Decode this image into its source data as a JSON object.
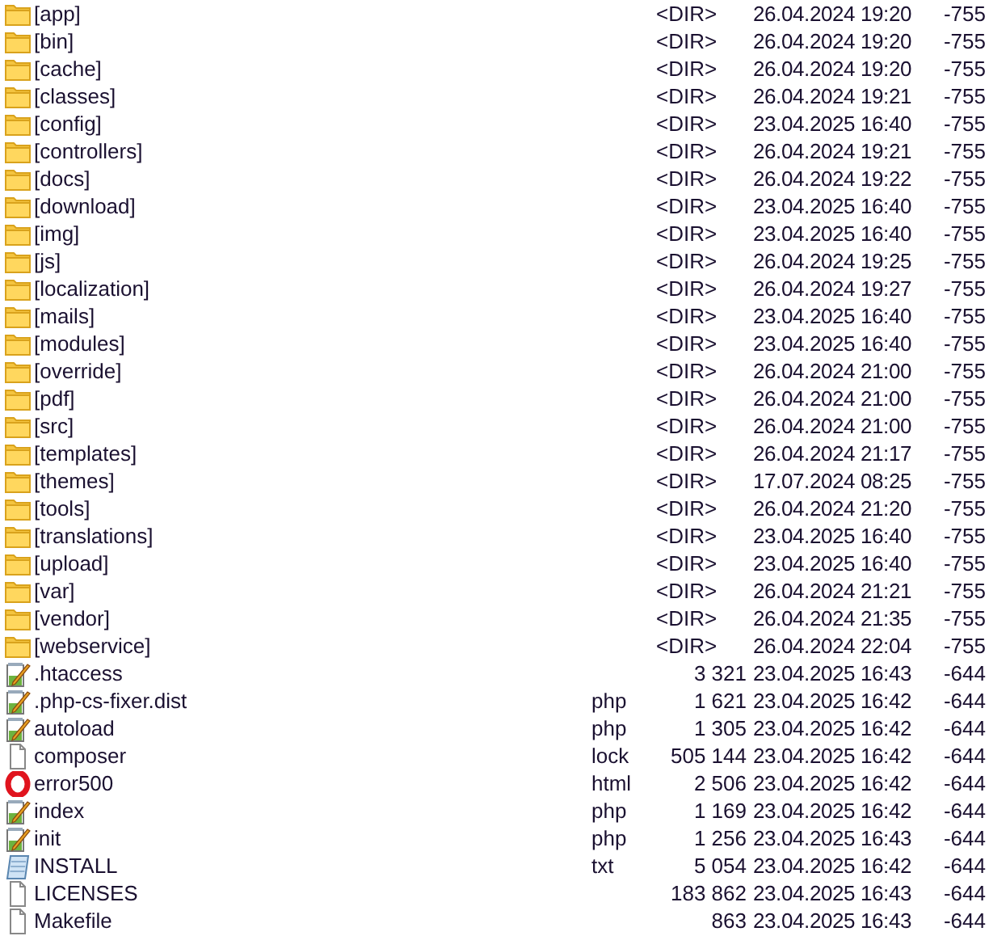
{
  "files": [
    {
      "kind": "folder",
      "name": "[app]",
      "size": "<DIR>",
      "date": "26.04.2024 19:20",
      "attr": "-755"
    },
    {
      "kind": "folder",
      "name": "[bin]",
      "size": "<DIR>",
      "date": "26.04.2024 19:20",
      "attr": "-755"
    },
    {
      "kind": "folder",
      "name": "[cache]",
      "size": "<DIR>",
      "date": "26.04.2024 19:20",
      "attr": "-755"
    },
    {
      "kind": "folder",
      "name": "[classes]",
      "size": "<DIR>",
      "date": "26.04.2024 19:21",
      "attr": "-755"
    },
    {
      "kind": "folder",
      "name": "[config]",
      "size": "<DIR>",
      "date": "23.04.2025 16:40",
      "attr": "-755"
    },
    {
      "kind": "folder",
      "name": "[controllers]",
      "size": "<DIR>",
      "date": "26.04.2024 19:21",
      "attr": "-755"
    },
    {
      "kind": "folder",
      "name": "[docs]",
      "size": "<DIR>",
      "date": "26.04.2024 19:22",
      "attr": "-755"
    },
    {
      "kind": "folder",
      "name": "[download]",
      "size": "<DIR>",
      "date": "23.04.2025 16:40",
      "attr": "-755"
    },
    {
      "kind": "folder",
      "name": "[img]",
      "size": "<DIR>",
      "date": "23.04.2025 16:40",
      "attr": "-755"
    },
    {
      "kind": "folder",
      "name": "[js]",
      "size": "<DIR>",
      "date": "26.04.2024 19:25",
      "attr": "-755"
    },
    {
      "kind": "folder",
      "name": "[localization]",
      "size": "<DIR>",
      "date": "26.04.2024 19:27",
      "attr": "-755"
    },
    {
      "kind": "folder",
      "name": "[mails]",
      "size": "<DIR>",
      "date": "23.04.2025 16:40",
      "attr": "-755"
    },
    {
      "kind": "folder",
      "name": "[modules]",
      "size": "<DIR>",
      "date": "23.04.2025 16:40",
      "attr": "-755"
    },
    {
      "kind": "folder",
      "name": "[override]",
      "size": "<DIR>",
      "date": "26.04.2024 21:00",
      "attr": "-755"
    },
    {
      "kind": "folder",
      "name": "[pdf]",
      "size": "<DIR>",
      "date": "26.04.2024 21:00",
      "attr": "-755"
    },
    {
      "kind": "folder",
      "name": "[src]",
      "size": "<DIR>",
      "date": "26.04.2024 21:00",
      "attr": "-755"
    },
    {
      "kind": "folder",
      "name": "[templates]",
      "size": "<DIR>",
      "date": "26.04.2024 21:17",
      "attr": "-755"
    },
    {
      "kind": "folder",
      "name": "[themes]",
      "size": "<DIR>",
      "date": "17.07.2024 08:25",
      "attr": "-755"
    },
    {
      "kind": "folder",
      "name": "[tools]",
      "size": "<DIR>",
      "date": "26.04.2024 21:20",
      "attr": "-755"
    },
    {
      "kind": "folder",
      "name": "[translations]",
      "size": "<DIR>",
      "date": "23.04.2025 16:40",
      "attr": "-755"
    },
    {
      "kind": "folder",
      "name": "[upload]",
      "size": "<DIR>",
      "date": "23.04.2025 16:40",
      "attr": "-755"
    },
    {
      "kind": "folder",
      "name": "[var]",
      "size": "<DIR>",
      "date": "26.04.2024 21:21",
      "attr": "-755"
    },
    {
      "kind": "folder",
      "name": "[vendor]",
      "size": "<DIR>",
      "date": "26.04.2024 21:35",
      "attr": "-755"
    },
    {
      "kind": "folder",
      "name": "[webservice]",
      "size": "<DIR>",
      "date": "26.04.2024 22:04",
      "attr": "-755"
    },
    {
      "kind": "script",
      "name": ".htaccess",
      "size": "3 321",
      "date": "23.04.2025 16:43",
      "attr": "-644"
    },
    {
      "kind": "script",
      "name": ".php-cs-fixer.dist",
      "ext": "php",
      "size": "1 621",
      "date": "23.04.2025 16:42",
      "attr": "-644"
    },
    {
      "kind": "script",
      "name": "autoload",
      "ext": "php",
      "size": "1 305",
      "date": "23.04.2025 16:42",
      "attr": "-644"
    },
    {
      "kind": "blank",
      "name": "composer",
      "ext": "lock",
      "size": "505 144",
      "date": "23.04.2025 16:42",
      "attr": "-644"
    },
    {
      "kind": "browser",
      "name": "error500",
      "ext": "html",
      "size": "2 506",
      "date": "23.04.2025 16:42",
      "attr": "-644"
    },
    {
      "kind": "script",
      "name": "index",
      "ext": "php",
      "size": "1 169",
      "date": "23.04.2025 16:42",
      "attr": "-644"
    },
    {
      "kind": "script",
      "name": "init",
      "ext": "php",
      "size": "1 256",
      "date": "23.04.2025 16:43",
      "attr": "-644"
    },
    {
      "kind": "notes",
      "name": "INSTALL",
      "ext": "txt",
      "size": "5 054",
      "date": "23.04.2025 16:42",
      "attr": "-644"
    },
    {
      "kind": "blank",
      "name": "LICENSES",
      "size": "183 862",
      "date": "23.04.2025 16:43",
      "attr": "-644"
    },
    {
      "kind": "blank",
      "name": "Makefile",
      "size": "863",
      "date": "23.04.2025 16:43",
      "attr": "-644"
    }
  ]
}
